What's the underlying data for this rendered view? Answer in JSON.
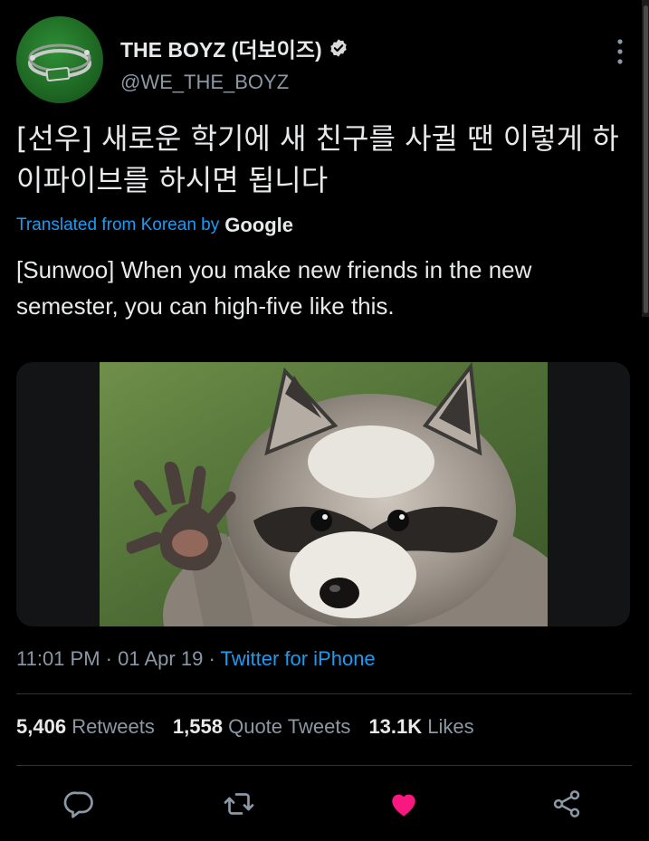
{
  "author": {
    "name": "THE BOYZ (더보이즈)",
    "handle": "@WE_THE_BOYZ",
    "verified_icon": "verified-badge-icon",
    "avatar_label": "THE BOYZ logo"
  },
  "tweet": {
    "text": "[선우] 새로운 학기에 새 친구를 사귈 땐 이렇게 하이파이브를 하시면 됩니다",
    "translation_label": "Translated from Korean by",
    "translation_provider": "Google",
    "translation": "[Sunwoo] When you make new friends in the new semester, you can high-five like this."
  },
  "media": {
    "alt": "raccoon raising its paw"
  },
  "meta": {
    "time": "11:01 PM",
    "separator": "·",
    "date": "01 Apr 19",
    "source": "Twitter for iPhone"
  },
  "stats": {
    "retweets_count": "5,406",
    "retweets_label": "Retweets",
    "quotes_count": "1,558",
    "quotes_label": "Quote Tweets",
    "likes_count": "13.1K",
    "likes_label": "Likes"
  },
  "actions": {
    "reply": "reply-icon",
    "retweet": "retweet-icon",
    "like": "heart-icon",
    "share": "share-icon"
  },
  "colors": {
    "background": "#000000",
    "text": "#e7e9ea",
    "muted": "#8b98a5",
    "link": "#1d9bf0",
    "like": "#f91880",
    "divider": "#2f3336"
  }
}
